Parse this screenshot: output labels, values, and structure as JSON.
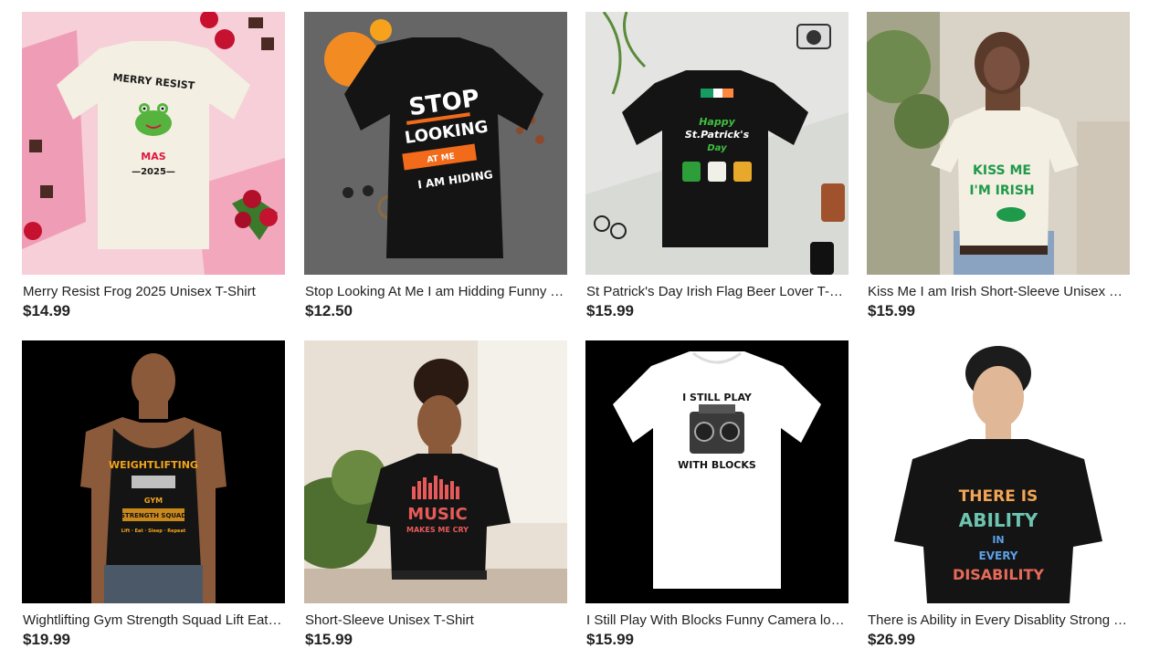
{
  "products": [
    {
      "title": "Merry Resist Frog 2025 Unisex T-Shirt",
      "price": "$14.99",
      "print": {
        "line1": "MERRY RESIST",
        "line2": "MAS",
        "line3": "—2025—"
      }
    },
    {
      "title": "Stop Looking At Me I am Hidding Funny T-Shirt",
      "price": "$12.50",
      "print": {
        "line1": "STOP",
        "line2": "LOOKING",
        "line3": "AT ME",
        "line4": "I AM HIDING"
      }
    },
    {
      "title": "St Patrick's Day Irish Flag Beer Lover T-Shirt",
      "price": "$15.99",
      "print": {
        "line1": "Happy",
        "line2": "St.Patrick's",
        "line3": "Day"
      }
    },
    {
      "title": "Kiss Me I am Irish Short-Sleeve Unisex T-Shirt",
      "price": "$15.99",
      "print": {
        "line1": "KISS ME",
        "line2": "I'M IRISH"
      }
    },
    {
      "title": "Wightlifting Gym Strength Squad Lift Eat Sleep Repeat Tank Top",
      "price": "$19.99",
      "print": {
        "line1": "WEIGHTLIFTING",
        "line2": "GYM",
        "line3": "STRENGTH SQUAD",
        "line4": "Lift · Eat · Sleep · Repeat"
      }
    },
    {
      "title": "Short-Sleeve Unisex T-Shirt",
      "price": "$15.99",
      "print": {
        "line1": "MUSIC",
        "line2": "MAKES ME CRY"
      }
    },
    {
      "title": "I Still Play With Blocks Funny Camera lover T-Shirt",
      "price": "$15.99",
      "print": {
        "line1": "I STILL PLAY",
        "line2": "WITH BLOCKS"
      }
    },
    {
      "title": "There is Ability in Every Disablity Strong T-Shirt",
      "price": "$26.99",
      "print": {
        "line1": "THERE IS",
        "line2": "ABILITY",
        "line3": "IN",
        "line4": "EVERY",
        "line5": "DISABILITY"
      }
    }
  ],
  "colors": {
    "text": "#222222",
    "shirt_black": "#141414",
    "shirt_cream": "#f3efe2",
    "shirt_white": "#ffffff"
  }
}
